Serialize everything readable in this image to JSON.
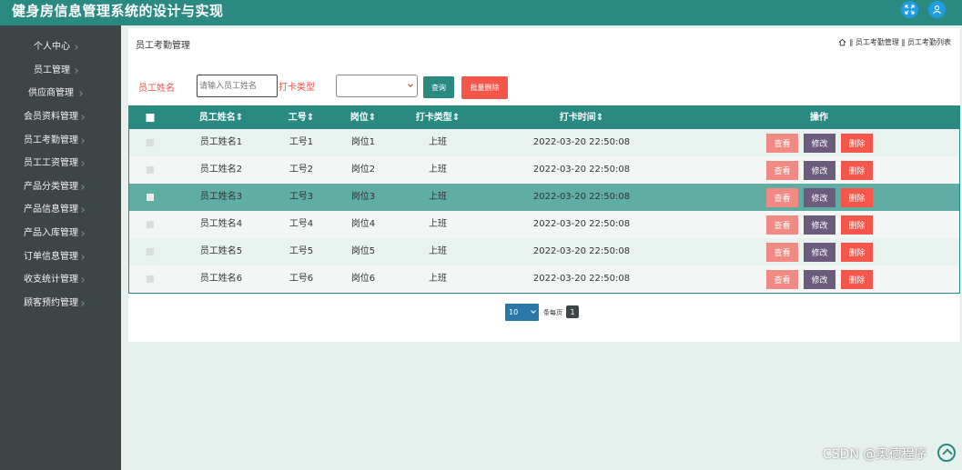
{
  "app": {
    "title": "健身房信息管理系统的设计与实现"
  },
  "header_icons": [
    "expand-icon",
    "user-icon"
  ],
  "sidebar": {
    "items": [
      {
        "label": "个人中心"
      },
      {
        "label": "员工管理"
      },
      {
        "label": "供应商管理"
      },
      {
        "label": "会员资料管理"
      },
      {
        "label": "员工考勤管理"
      },
      {
        "label": "员工工资管理"
      },
      {
        "label": "产品分类管理"
      },
      {
        "label": "产品信息管理"
      },
      {
        "label": "产品入库管理"
      },
      {
        "label": "订单信息管理"
      },
      {
        "label": "收支统计管理"
      },
      {
        "label": "顾客预约管理"
      }
    ]
  },
  "page": {
    "title": "员工考勤管理",
    "breadcrumb": "‖ 员工考勤管理 ‖ 员工考勤列表"
  },
  "search": {
    "name_label": "员工姓名",
    "name_placeholder": "请输入员工姓名",
    "type_label": "打卡类型",
    "type_value": "",
    "query_label": "查询",
    "batch_delete_label": "批量删除"
  },
  "table": {
    "columns": [
      "员工姓名",
      "工号",
      "岗位",
      "打卡类型",
      "打卡时间",
      "操作"
    ],
    "rows": [
      {
        "name": "员工姓名1",
        "no": "工号1",
        "post": "岗位1",
        "type": "上班",
        "time": "2022-03-20 22:50:08"
      },
      {
        "name": "员工姓名2",
        "no": "工号2",
        "post": "岗位2",
        "type": "上班",
        "time": "2022-03-20 22:50:08"
      },
      {
        "name": "员工姓名3",
        "no": "工号3",
        "post": "岗位3",
        "type": "上班",
        "time": "2022-03-20 22:50:08"
      },
      {
        "name": "员工姓名4",
        "no": "工号4",
        "post": "岗位4",
        "type": "上班",
        "time": "2022-03-20 22:50:08"
      },
      {
        "name": "员工姓名5",
        "no": "工号5",
        "post": "岗位5",
        "type": "上班",
        "time": "2022-03-20 22:50:08"
      },
      {
        "name": "员工姓名6",
        "no": "工号6",
        "post": "岗位6",
        "type": "上班",
        "time": "2022-03-20 22:50:08"
      }
    ],
    "actions": {
      "view": "查看",
      "edit": "修改",
      "delete": "删除"
    },
    "highlighted_row": 3
  },
  "pager": {
    "page_size": "10",
    "per_page_label": "条每页",
    "current_page": "1"
  },
  "colors": {
    "primary": "#2a8a82",
    "sidebar": "#3d4547",
    "danger": "#f5564a",
    "view": "#f08a82",
    "edit": "#6b5b7d",
    "highlight_row": "#5fada3"
  },
  "watermark": "CSDN @奥德程序"
}
